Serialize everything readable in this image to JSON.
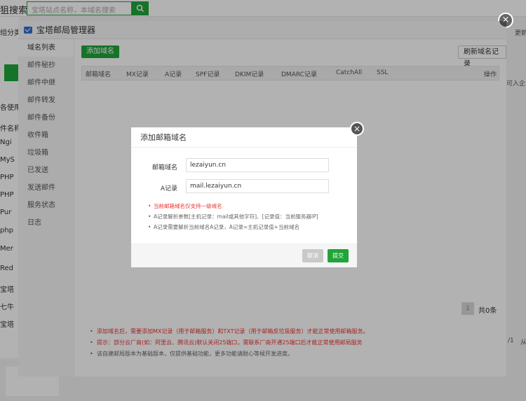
{
  "background": {
    "title": "狙搜索",
    "search_placeholder": "宝塔站点名称，本域名搜索",
    "left_items": [
      "组分类",
      "各使用人",
      "件名称",
      "Ngi",
      "MyS",
      "PHP",
      "PHP",
      "Pur",
      "php",
      "Mer",
      "Red",
      "宝塔",
      "七牛",
      "宝塔"
    ],
    "right_texts": [
      "更新",
      "可入企业",
      "/1",
      "从"
    ]
  },
  "main_dialog": {
    "title": "宝塔邮局管理器",
    "close_label": "×",
    "sidebar": [
      "域名列表",
      "邮件秘抄",
      "邮件中继",
      "邮件转发",
      "邮件备份",
      "收件箱",
      "垃圾箱",
      "已发送",
      "发送邮件",
      "服务状态",
      "日志"
    ],
    "add_domain_button": "添加域名",
    "refresh_button": "刷新域名记录",
    "table_headers": [
      "邮箱域名",
      "MX记录",
      "A记录",
      "SPF记录",
      "DKIM记录",
      "DMARC记录",
      "CatchAll",
      "SSL",
      "操作"
    ],
    "pager_page": "1",
    "pager_total": "共0条",
    "tips": [
      "添加域名后，需要添加MX记录（用于邮箱服务）和TXT记录（用于邮箱反垃圾服务）才能正常使用邮箱服务。",
      "提示：部分云厂商(如：阿里云、腾讯云)默认关闭25端口，需联系厂商开通25端口后才能正常使用邮局服务",
      "该自建邮局版本为基础版本，仅提供基础功能，更多功能请耐心等候开发进度。"
    ]
  },
  "add_dialog": {
    "title": "添加邮箱域名",
    "close_label": "×",
    "domain_label": "邮箱域名",
    "domain_value": "lezaiyun.cn",
    "a_record_label": "A记录",
    "a_record_value": "mail.lezaiyun.cn",
    "tips": [
      "当前邮箱域名仅支持一级域名",
      "A记录解析参数[主机记录：mail或其他字符]、[记录值：当前服务器IP]",
      "A记录需要解析当前域名A记录，A记录=主机记录值+当前域名"
    ],
    "cancel_button": "取消",
    "submit_button": "提交"
  },
  "colors": {
    "accent": "#20a53a",
    "warning": "#ee3333"
  }
}
